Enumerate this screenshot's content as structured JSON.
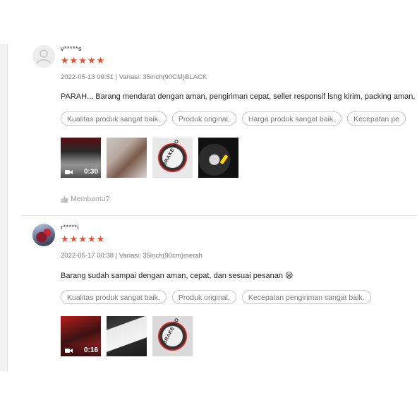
{
  "colors": {
    "star": "#ee4d2d",
    "muted_text": "rgba(0,0,0,.54)",
    "tag_border": "rgba(0,0,0,.22)"
  },
  "reviews": [
    {
      "username": "v*****s",
      "avatar_icon": "default-user-icon",
      "rating": 5,
      "stars": [
        "★",
        "★",
        "★",
        "★",
        "★"
      ],
      "meta": "2022-05-13 09:51 | Variasi: 35inch(90CM)BLACK",
      "comment": "PARAH... Barang mendarat dengan aman, pengiriman cepat, seller responsif lsng kirim, packing aman,",
      "tags": [
        "Kualitas produk sangat baik.",
        "Produk original.",
        "Harga produk sangat baik.",
        "Kecepatan pe"
      ],
      "media": [
        {
          "type": "video",
          "duration": "0:30",
          "icon": "video-camera-icon"
        },
        {
          "type": "image"
        },
        {
          "type": "image",
          "label": "BRAKE HO"
        },
        {
          "type": "image"
        }
      ],
      "helpful_label": "Membantu?",
      "helpful_icon": "thumbs-up-icon"
    },
    {
      "username": "r*****i",
      "avatar_icon": "user-photo",
      "rating": 5,
      "stars": [
        "★",
        "★",
        "★",
        "★",
        "★"
      ],
      "meta": "2022-05-17 00:38 | Variasi: 35inch(90cm)merah",
      "comment": "Barang sudah sampai dengan aman, cepat, dan sesuai pesanan 😪",
      "tags": [
        "Kualitas produk sangat baik.",
        "Produk original.",
        "Kecepatan pengiriman sangat baik."
      ],
      "media": [
        {
          "type": "video",
          "duration": "0:16",
          "icon": "video-camera-icon"
        },
        {
          "type": "image"
        },
        {
          "type": "image",
          "label": "BRAKE HO"
        }
      ]
    }
  ]
}
